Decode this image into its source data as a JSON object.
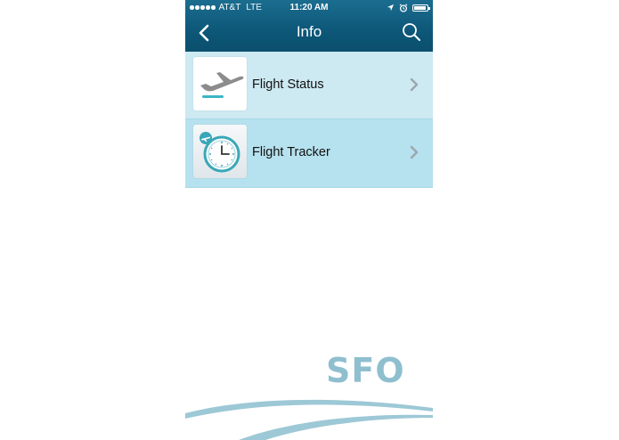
{
  "status_bar": {
    "carrier": "AT&T",
    "network": "LTE",
    "time": "11:20 AM"
  },
  "nav": {
    "title": "Info",
    "back_icon": "chevron-left-icon",
    "search_icon": "search-icon"
  },
  "list": {
    "items": [
      {
        "label": "Flight Status",
        "icon": "airplane-departure-icon"
      },
      {
        "label": "Flight Tracker",
        "icon": "clock-airplane-icon"
      }
    ]
  },
  "footer": {
    "logo_text": "SFO"
  },
  "colors": {
    "nav_bar": "#0d5778",
    "row_1": "#cde9f2",
    "row_2": "#b6e1ee",
    "accent": "#3bb6c6",
    "logo": "#8fbfcf"
  }
}
